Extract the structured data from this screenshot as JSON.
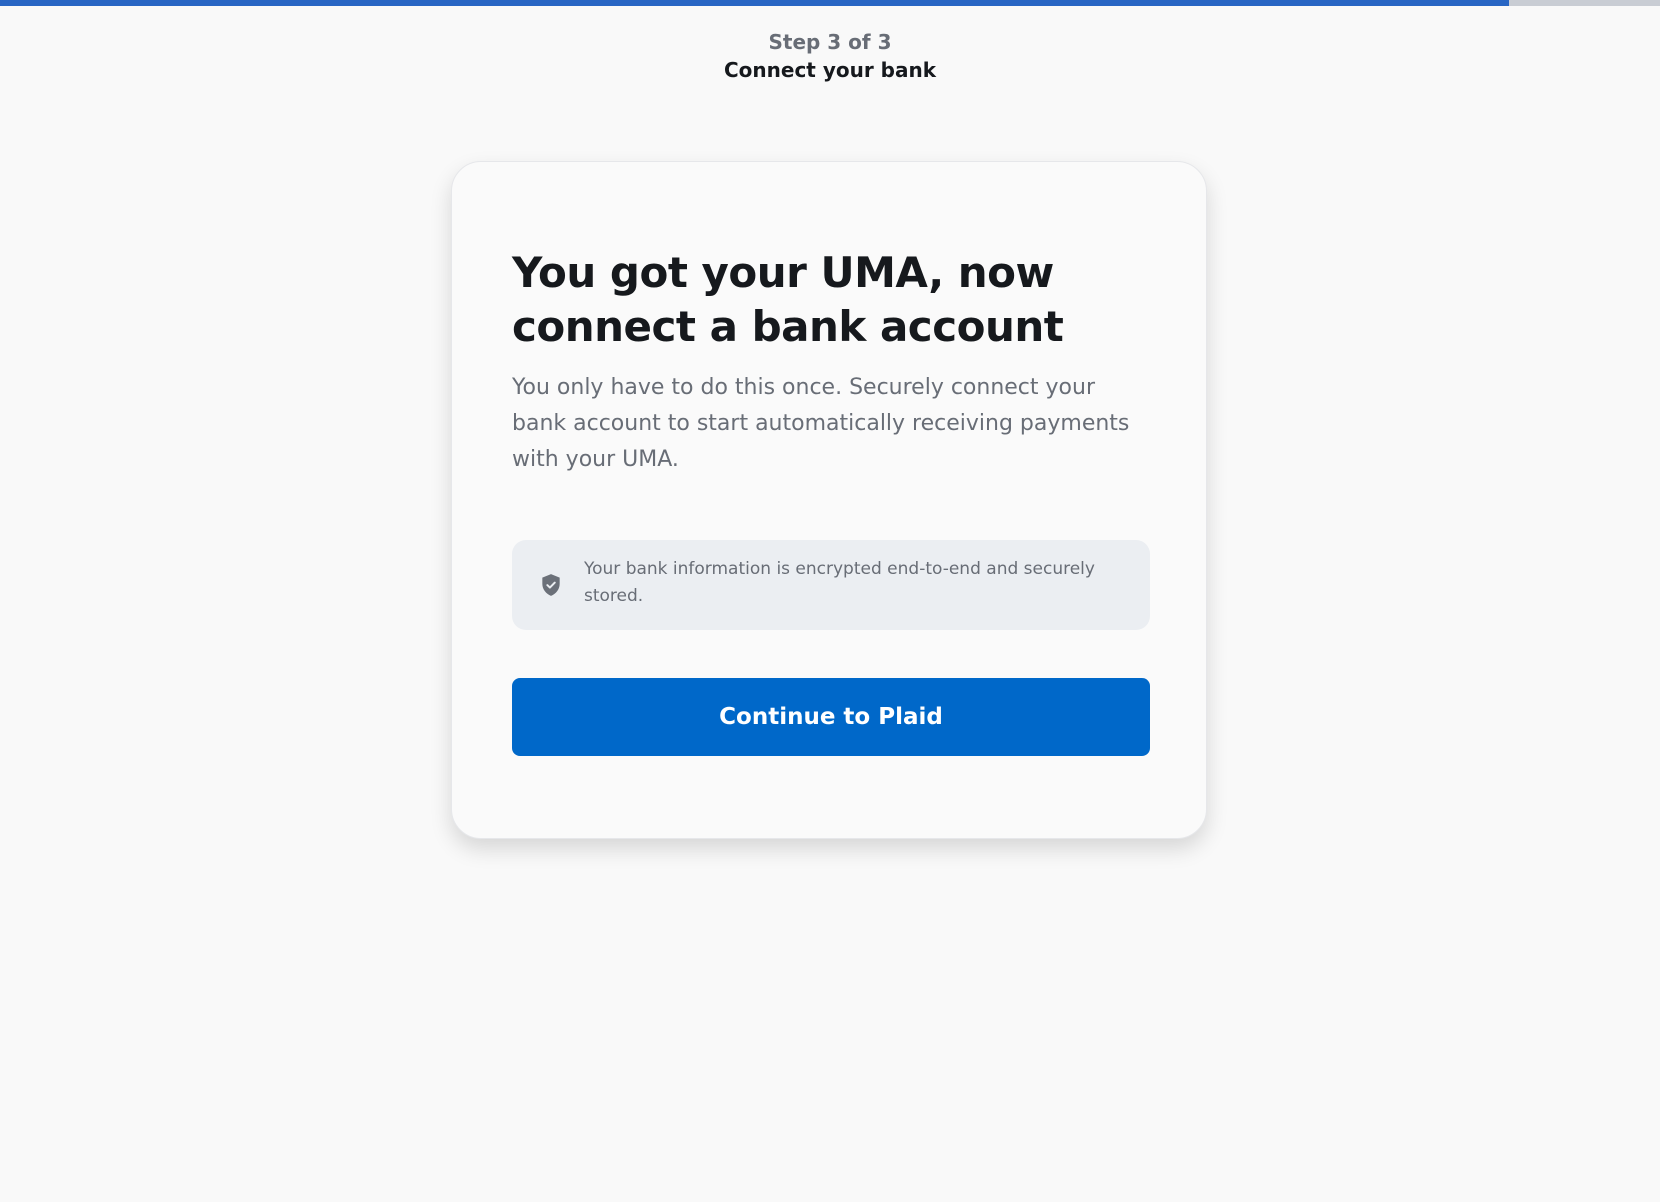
{
  "progress": {
    "fraction": 0.909,
    "fill_color": "#2866c4",
    "track_color": "#c9cdd4"
  },
  "header": {
    "step_label": "Step 3 of 3",
    "title": "Connect your bank"
  },
  "card": {
    "title": "You got your UMA, now connect a bank account",
    "description": "You only have to do this once. Securely connect your bank account to start automatically receiving payments with your UMA.",
    "notice": {
      "icon": "shield-check-icon",
      "text": "Your bank information is encrypted end-to-end and securely stored."
    },
    "cta_label": "Continue to Plaid",
    "cta_color": "#0068c9"
  }
}
